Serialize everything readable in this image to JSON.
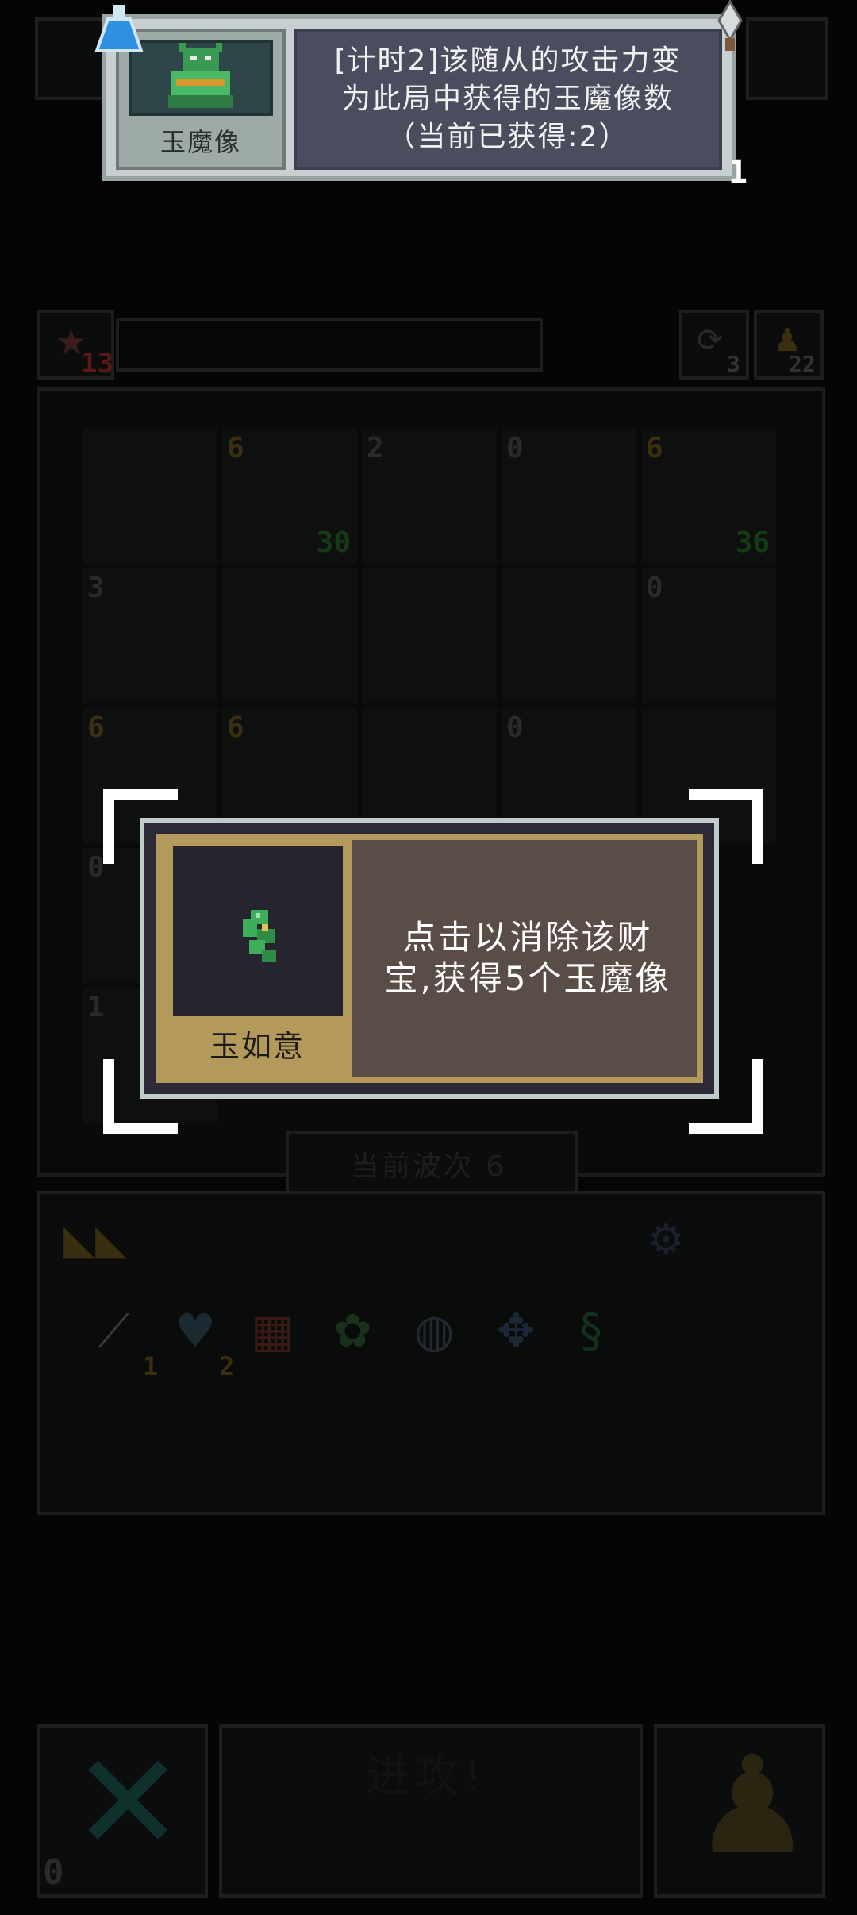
{
  "tooltip": {
    "unit_name": "玉魔像",
    "desc_line1": "[计时2]该随从的攻击力变",
    "desc_line2": "为此局中获得的玉魔像数",
    "desc_line3": "（当前已获得:2）",
    "corner_number": "1"
  },
  "status": {
    "star_count": "13",
    "refresh_count": "3",
    "key_count": "22"
  },
  "board": {
    "badges": [
      {
        "num": "6",
        "bottom": "30"
      },
      {
        "num": "2"
      },
      {
        "num": "0"
      },
      {
        "num": "6",
        "bottom": "36"
      },
      {
        "num": "3"
      },
      {
        "num": "0"
      },
      {
        "num": "6"
      },
      {
        "num": "6"
      },
      {
        "num": "0"
      },
      {
        "num": "0"
      },
      {
        "num": "1"
      }
    ]
  },
  "popup": {
    "item_name": "玉如意",
    "desc_line1": "点击以消除该财",
    "desc_line2": "宝,获得5个玉魔像"
  },
  "wave": {
    "label": "当前波次 6"
  },
  "inventory": {
    "bone_count": "1",
    "heart_count": "2"
  },
  "bottom": {
    "cancel_count": "0",
    "attack_label": "进攻!"
  },
  "colors": {
    "popup_gold": "#b39a5c",
    "tooltip_panel": "#4a4d5d",
    "jade_green": "#3fae5a"
  }
}
